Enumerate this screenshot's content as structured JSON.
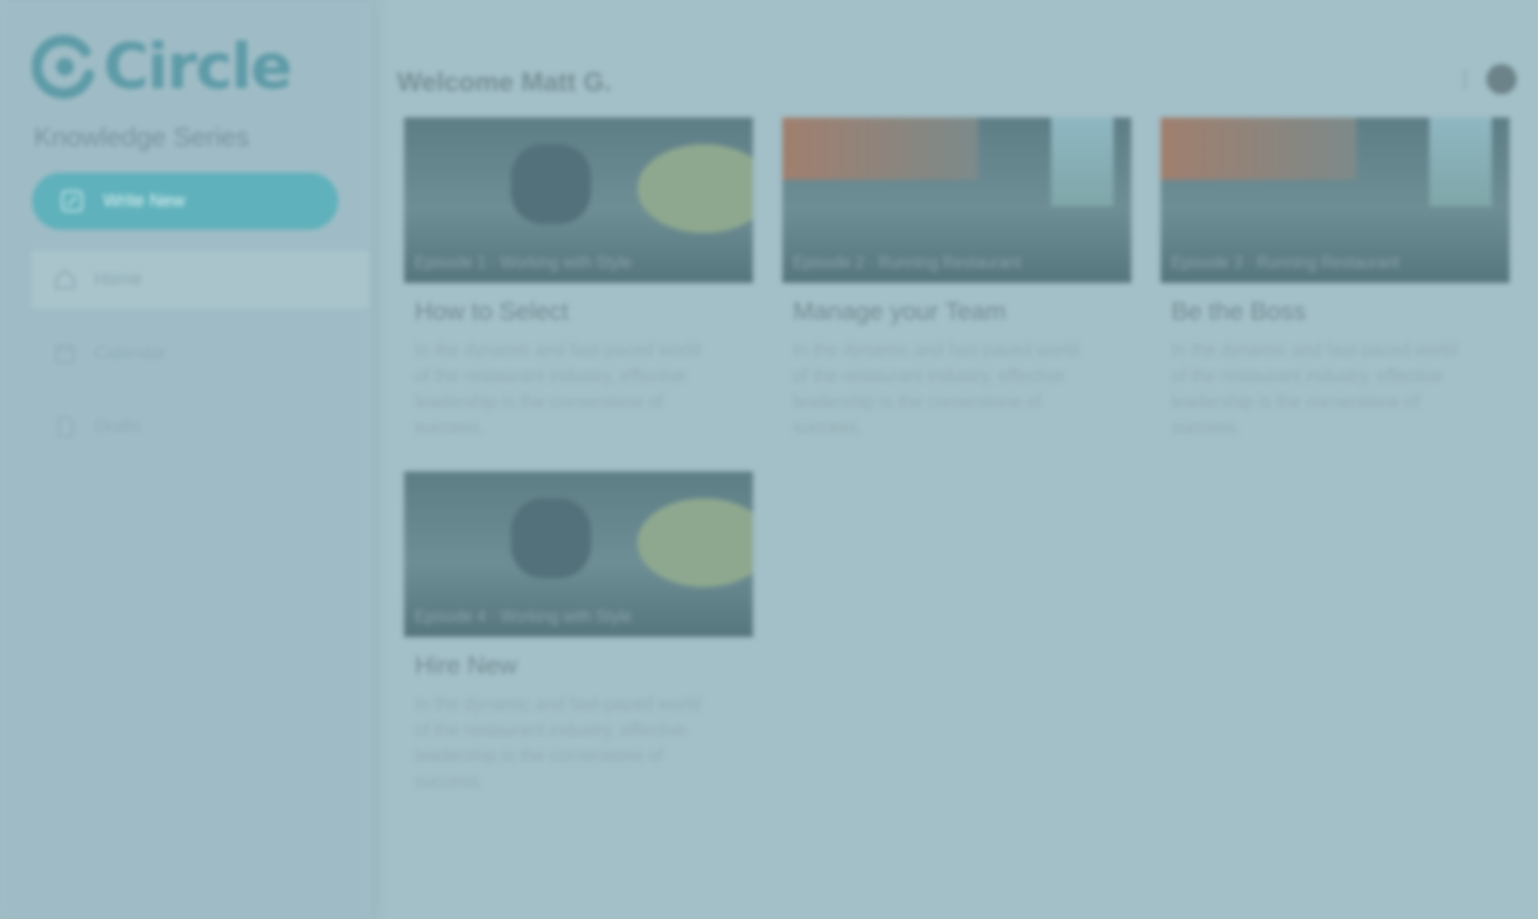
{
  "sidebar": {
    "logo_text": "Circle",
    "subtitle": "Knowledge Series",
    "primary_button": "Write New",
    "nav": [
      {
        "label": "Home",
        "icon": "home-icon"
      },
      {
        "label": "Calendar",
        "icon": "calendar-icon"
      },
      {
        "label": "Drafts",
        "icon": "document-icon"
      }
    ]
  },
  "main": {
    "title": "Welcome Matt G.",
    "cards": [
      {
        "image_tag": "Episode 1 · Working with Style",
        "title": "How to Select",
        "text": "In the dynamic and fast-paced world of the restaurant industry, effective leadership is the cornerstone of success."
      },
      {
        "image_tag": "Episode 2 · Running Restaurant",
        "title": "Manage your Team",
        "text": "In the dynamic and fast-paced world of the restaurant industry, effective leadership is the cornerstone of success."
      },
      {
        "image_tag": "Episode 3 · Running Restaurant",
        "title": "Be the Boss",
        "text": "In the dynamic and fast-paced world of the restaurant industry, effective leadership is the cornerstone of success."
      },
      {
        "image_tag": "Episode 4 · Working with Style",
        "title": "Hire New",
        "text": "In the dynamic and fast-paced world of the restaurant industry, effective leadership is the cornerstone of success."
      }
    ]
  },
  "colors": {
    "overlay": "#a3bfc7",
    "accent": "#5fb1bb",
    "logo": "#5d9ba7"
  }
}
